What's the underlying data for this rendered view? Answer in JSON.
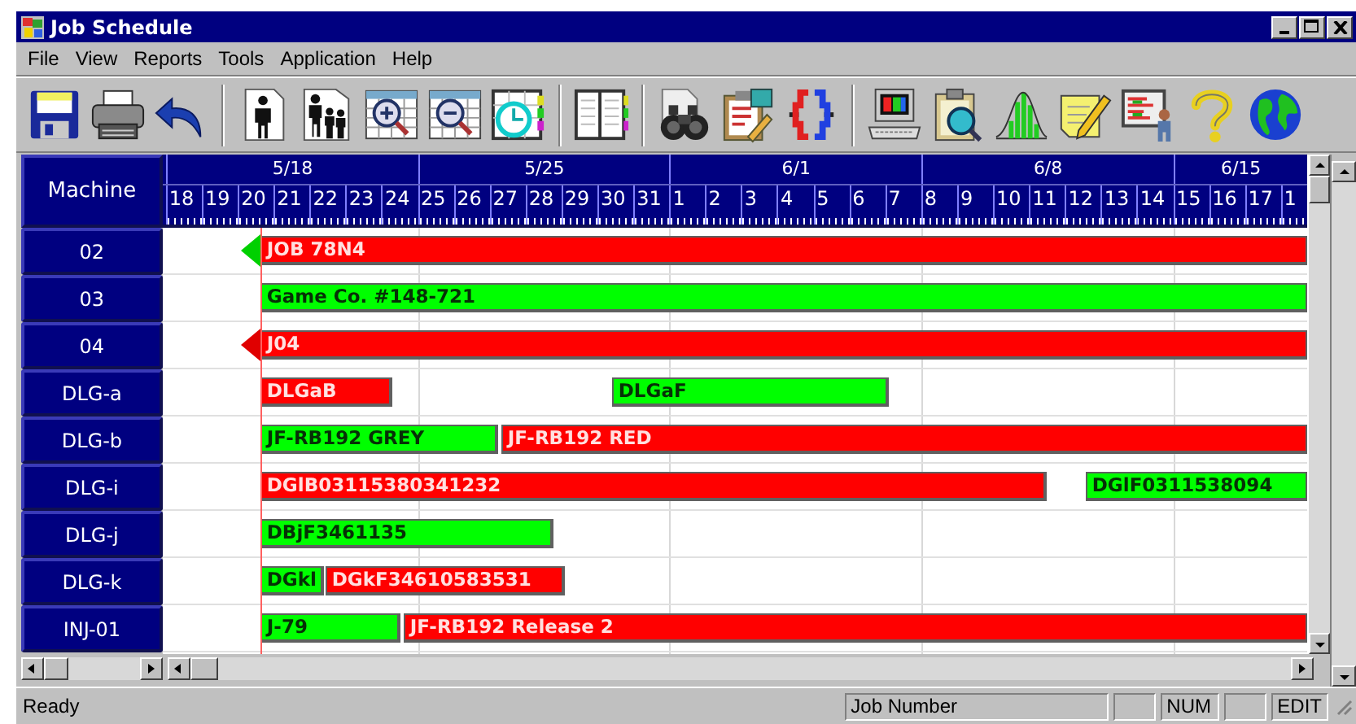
{
  "window": {
    "title": "Job Schedule"
  },
  "menu": [
    "File",
    "View",
    "Reports",
    "Tools",
    "Application",
    "Help"
  ],
  "toolbar": [
    {
      "kind": "save"
    },
    {
      "kind": "print"
    },
    {
      "kind": "undo"
    },
    {
      "kind": "separator"
    },
    {
      "kind": "person"
    },
    {
      "kind": "people"
    },
    {
      "kind": "zoom-in"
    },
    {
      "kind": "zoom-out"
    },
    {
      "kind": "clock"
    },
    {
      "kind": "separator"
    },
    {
      "kind": "book"
    },
    {
      "kind": "separator"
    },
    {
      "kind": "binoculars"
    },
    {
      "kind": "clipboard"
    },
    {
      "kind": "split"
    },
    {
      "kind": "separator"
    },
    {
      "kind": "computer"
    },
    {
      "kind": "inspect"
    },
    {
      "kind": "chart"
    },
    {
      "kind": "note"
    },
    {
      "kind": "presenter"
    },
    {
      "kind": "help"
    },
    {
      "kind": "globe"
    }
  ],
  "gantt": {
    "column_header": "Machine",
    "weeks": [
      {
        "label": "5/18"
      },
      {
        "label": "5/25"
      },
      {
        "label": "6/1"
      },
      {
        "label": "6/8"
      },
      {
        "label": "6/15"
      }
    ],
    "days": [
      "18",
      "19",
      "20",
      "21",
      "22",
      "23",
      "24",
      "25",
      "26",
      "27",
      "28",
      "29",
      "30",
      "31",
      "1",
      "2",
      "3",
      "4",
      "5",
      "6",
      "7",
      "8",
      "9",
      "10",
      "11",
      "12",
      "13",
      "14",
      "15",
      "16",
      "17",
      "1"
    ],
    "rows": [
      {
        "machine": "02",
        "bars": [
          {
            "label": "JOB 78N4",
            "color": "#ff0000",
            "arrow": {
              "color": "#00d000"
            }
          }
        ]
      },
      {
        "machine": "03",
        "bars": [
          {
            "label": "Game Co. #148-721",
            "color": "#00ff00"
          }
        ]
      },
      {
        "machine": "04",
        "bars": [
          {
            "label": "J04",
            "color": "#ff0000",
            "arrow": {
              "color": "#e00000"
            }
          }
        ]
      },
      {
        "machine": "DLG-a",
        "bars": [
          {
            "label": "DLGaB",
            "color": "#ff0000"
          },
          {
            "label": "DLGaF",
            "color": "#00ff00"
          }
        ]
      },
      {
        "machine": "DLG-b",
        "bars": [
          {
            "label": "JF-RB192 GREY",
            "color": "#00ff00"
          },
          {
            "label": "JF-RB192 RED",
            "color": "#ff0000"
          }
        ]
      },
      {
        "machine": "DLG-i",
        "bars": [
          {
            "label": "DGlB03115380341232",
            "color": "#ff0000"
          },
          {
            "label": "DGlF0311538094",
            "color": "#00ff00"
          }
        ]
      },
      {
        "machine": "DLG-j",
        "bars": [
          {
            "label": "DBjF3461135",
            "color": "#00ff00"
          }
        ]
      },
      {
        "machine": "DLG-k",
        "bars": [
          {
            "label": "DGkl",
            "color": "#00ff00"
          },
          {
            "label": "DGkF34610583531",
            "color": "#ff0000"
          }
        ]
      },
      {
        "machine": "INJ-01",
        "bars": [
          {
            "label": "J-79",
            "color": "#00ff00"
          },
          {
            "label": "JF-RB192 Release 2",
            "color": "#ff0000"
          }
        ]
      }
    ]
  },
  "status_bar": {
    "message": "Ready",
    "panels": [
      {
        "kind": "text",
        "text": "Job Number"
      },
      {
        "kind": "blank"
      },
      {
        "kind": "text",
        "text": "NUM"
      },
      {
        "kind": "blank"
      },
      {
        "kind": "text",
        "text": "EDIT"
      }
    ]
  }
}
